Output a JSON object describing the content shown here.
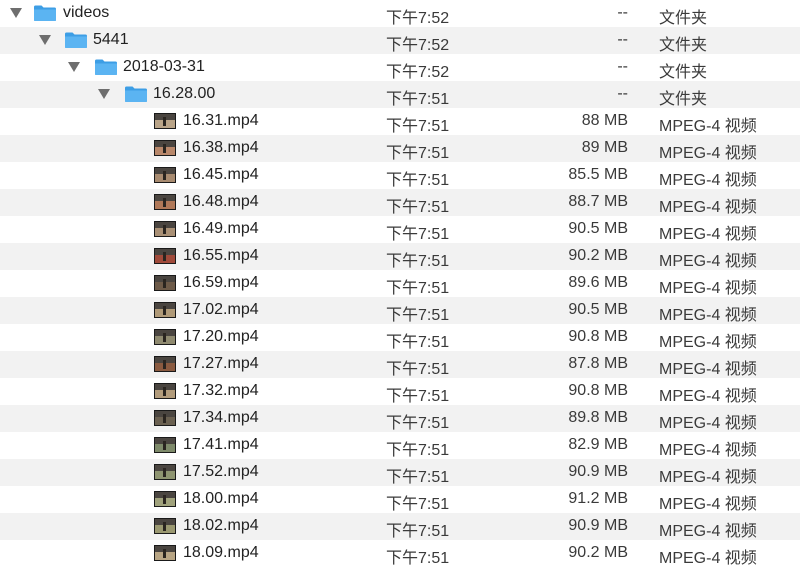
{
  "folders": [
    {
      "name": "videos",
      "date": "下午7:52",
      "size": "--",
      "kind": "文件夹",
      "depth": 0,
      "alt": false
    },
    {
      "name": "5441",
      "date": "下午7:52",
      "size": "--",
      "kind": "文件夹",
      "depth": 1,
      "alt": true
    },
    {
      "name": "2018-03-31",
      "date": "下午7:52",
      "size": "--",
      "kind": "文件夹",
      "depth": 2,
      "alt": false
    },
    {
      "name": "16.28.00",
      "date": "下午7:51",
      "size": "--",
      "kind": "文件夹",
      "depth": 3,
      "alt": true
    }
  ],
  "files": [
    {
      "name": "16.31.mp4",
      "date": "下午7:51",
      "size": "88 MB",
      "kind": "MPEG-4 视频",
      "thumb_color": "#b9a488"
    },
    {
      "name": "16.38.mp4",
      "date": "下午7:51",
      "size": "89 MB",
      "kind": "MPEG-4 视频",
      "thumb_color": "#b8876a"
    },
    {
      "name": "16.45.mp4",
      "date": "下午7:51",
      "size": "85.5 MB",
      "kind": "MPEG-4 视频",
      "thumb_color": "#a88b70"
    },
    {
      "name": "16.48.mp4",
      "date": "下午7:51",
      "size": "88.7 MB",
      "kind": "MPEG-4 视频",
      "thumb_color": "#b07858"
    },
    {
      "name": "16.49.mp4",
      "date": "下午7:51",
      "size": "90.5 MB",
      "kind": "MPEG-4 视频",
      "thumb_color": "#a99075"
    },
    {
      "name": "16.55.mp4",
      "date": "下午7:51",
      "size": "90.2 MB",
      "kind": "MPEG-4 视频",
      "thumb_color": "#a04a3a"
    },
    {
      "name": "16.59.mp4",
      "date": "下午7:51",
      "size": "89.6 MB",
      "kind": "MPEG-4 视频",
      "thumb_color": "#6d5a48"
    },
    {
      "name": "17.02.mp4",
      "date": "下午7:51",
      "size": "90.5 MB",
      "kind": "MPEG-4 视频",
      "thumb_color": "#b09a78"
    },
    {
      "name": "17.20.mp4",
      "date": "下午7:51",
      "size": "90.8 MB",
      "kind": "MPEG-4 视频",
      "thumb_color": "#8f8a70"
    },
    {
      "name": "17.27.mp4",
      "date": "下午7:51",
      "size": "87.8 MB",
      "kind": "MPEG-4 视频",
      "thumb_color": "#8a5a40"
    },
    {
      "name": "17.32.mp4",
      "date": "下午7:51",
      "size": "90.8 MB",
      "kind": "MPEG-4 视频",
      "thumb_color": "#b29c7c"
    },
    {
      "name": "17.34.mp4",
      "date": "下午7:51",
      "size": "89.8 MB",
      "kind": "MPEG-4 视频",
      "thumb_color": "#6a6050"
    },
    {
      "name": "17.41.mp4",
      "date": "下午7:51",
      "size": "82.9 MB",
      "kind": "MPEG-4 视频",
      "thumb_color": "#7e8a6a"
    },
    {
      "name": "17.52.mp4",
      "date": "下午7:51",
      "size": "90.9 MB",
      "kind": "MPEG-4 视频",
      "thumb_color": "#8e9470"
    },
    {
      "name": "18.00.mp4",
      "date": "下午7:51",
      "size": "91.2 MB",
      "kind": "MPEG-4 视频",
      "thumb_color": "#a0a27c"
    },
    {
      "name": "18.02.mp4",
      "date": "下午7:51",
      "size": "90.9 MB",
      "kind": "MPEG-4 视频",
      "thumb_color": "#9a9870"
    },
    {
      "name": "18.09.mp4",
      "date": "下午7:51",
      "size": "90.2 MB",
      "kind": "MPEG-4 视频",
      "thumb_color": "#b8a584"
    }
  ],
  "icons": {
    "folder": "folder-icon",
    "disclosure": "disclosure-triangle-icon",
    "video": "video-thumbnail-icon"
  },
  "colors": {
    "folder_blue": "#5bb4f2",
    "folder_blue_dark": "#3d9ee5",
    "stripe": "#f2f2f2",
    "triangle": "#6e6e6e"
  }
}
